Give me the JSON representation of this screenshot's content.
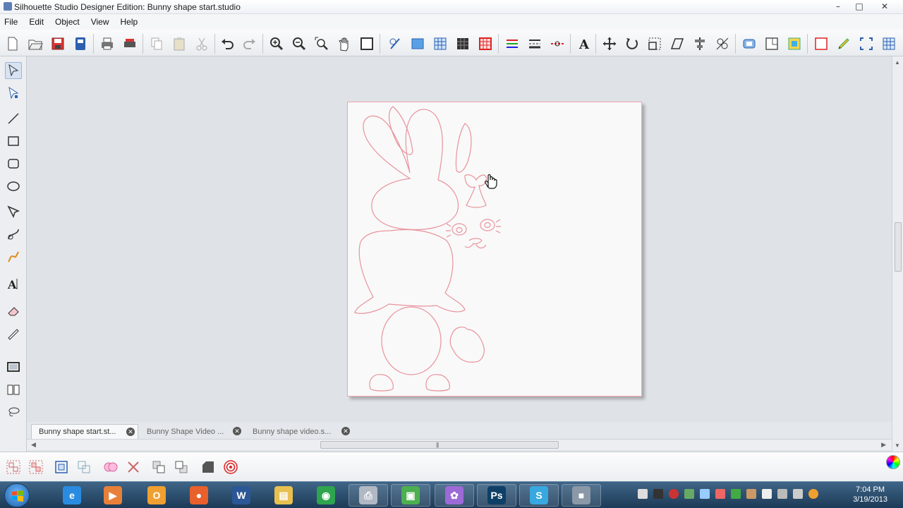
{
  "window": {
    "title": "Silhouette Studio Designer Edition: Bunny shape start.studio",
    "minimize": "–",
    "maximize": "□",
    "close": "✕"
  },
  "menu": [
    "File",
    "Edit",
    "Object",
    "View",
    "Help"
  ],
  "toolbar_icons": [
    "new-icon",
    "open-icon",
    "save-icon",
    "save-to-sd-icon",
    "print-icon",
    "send-to-silhouette-icon",
    "copy-icon",
    "paste-icon",
    "cut-icon",
    "undo-icon",
    "redo-icon",
    "zoom-in-icon",
    "zoom-out-icon",
    "zoom-selection-icon",
    "pan-icon",
    "fit-to-page-icon",
    "page-settings-icon",
    "grid-settings-icon",
    "registration-icon",
    "trace-icon",
    "cut-settings-icon",
    "line-color-icon",
    "line-style-icon",
    "cut-style-icon",
    "text-style-icon",
    "transform-icon",
    "rotate-icon",
    "scale-icon",
    "shear-icon",
    "align-icon",
    "replicate-icon",
    "offset-icon",
    "modify-icon",
    "fill-color-icon",
    "fill-gradient-icon",
    "sketch-icon",
    "knife-icon",
    "grid-icon"
  ],
  "left_tools": [
    "select-tool-icon",
    "edit-points-icon",
    "line-tool-icon",
    "rectangle-tool-icon",
    "rounded-rectangle-tool-icon",
    "ellipse-tool-icon",
    "polygon-tool-icon",
    "curve-tool-icon",
    "freehand-tool-icon",
    "text-tool-icon",
    "eraser-tool-icon",
    "knife-tool-icon",
    "cut-border-icon",
    "library-icon",
    "lasso-icon"
  ],
  "tabs": [
    {
      "label": "Bunny shape start.st...",
      "active": true
    },
    {
      "label": "Bunny Shape Video ...",
      "active": false
    },
    {
      "label": "Bunny shape video.s...",
      "active": false
    }
  ],
  "bottom_tools": [
    "group-icon",
    "ungroup-icon",
    "compound-path-icon",
    "release-compound-icon",
    "weld-icon",
    "delete-icon",
    "bring-forward-icon",
    "send-backward-icon",
    "shape-icon",
    "offset-target-icon"
  ],
  "taskbar": {
    "apps": [
      {
        "name": "internet-explorer-icon",
        "color": "#2a8ce0",
        "glyph": "e"
      },
      {
        "name": "media-player-icon",
        "color": "#e8803a",
        "glyph": "▶"
      },
      {
        "name": "outlook-icon",
        "color": "#f0a030",
        "glyph": "O"
      },
      {
        "name": "firefox-icon",
        "color": "#e8602c",
        "glyph": "●"
      },
      {
        "name": "word-icon",
        "color": "#2b5797",
        "glyph": "W"
      },
      {
        "name": "explorer-icon",
        "color": "#e8c050",
        "glyph": "▤"
      },
      {
        "name": "chrome-icon",
        "color": "#2ea44f",
        "glyph": "◉"
      },
      {
        "name": "printer-app-icon",
        "color": "#b0b8c4",
        "glyph": "⎙"
      },
      {
        "name": "camtasia-icon",
        "color": "#4caf50",
        "glyph": "▣"
      },
      {
        "name": "picasa-icon",
        "color": "#9c6ad6",
        "glyph": "✿"
      },
      {
        "name": "photoshop-icon",
        "color": "#0e3f66",
        "glyph": "Ps"
      },
      {
        "name": "silhouette-studio-icon",
        "color": "#38a8e0",
        "glyph": "S"
      },
      {
        "name": "recorder-icon",
        "color": "#8a98a8",
        "glyph": "■"
      }
    ],
    "clock_time": "7:04 PM",
    "clock_date": "3/19/2013"
  },
  "colors": {
    "cut_line": "#e8939d",
    "page_border": "#f0a3b0",
    "taskbar": "#2a4a6a"
  }
}
